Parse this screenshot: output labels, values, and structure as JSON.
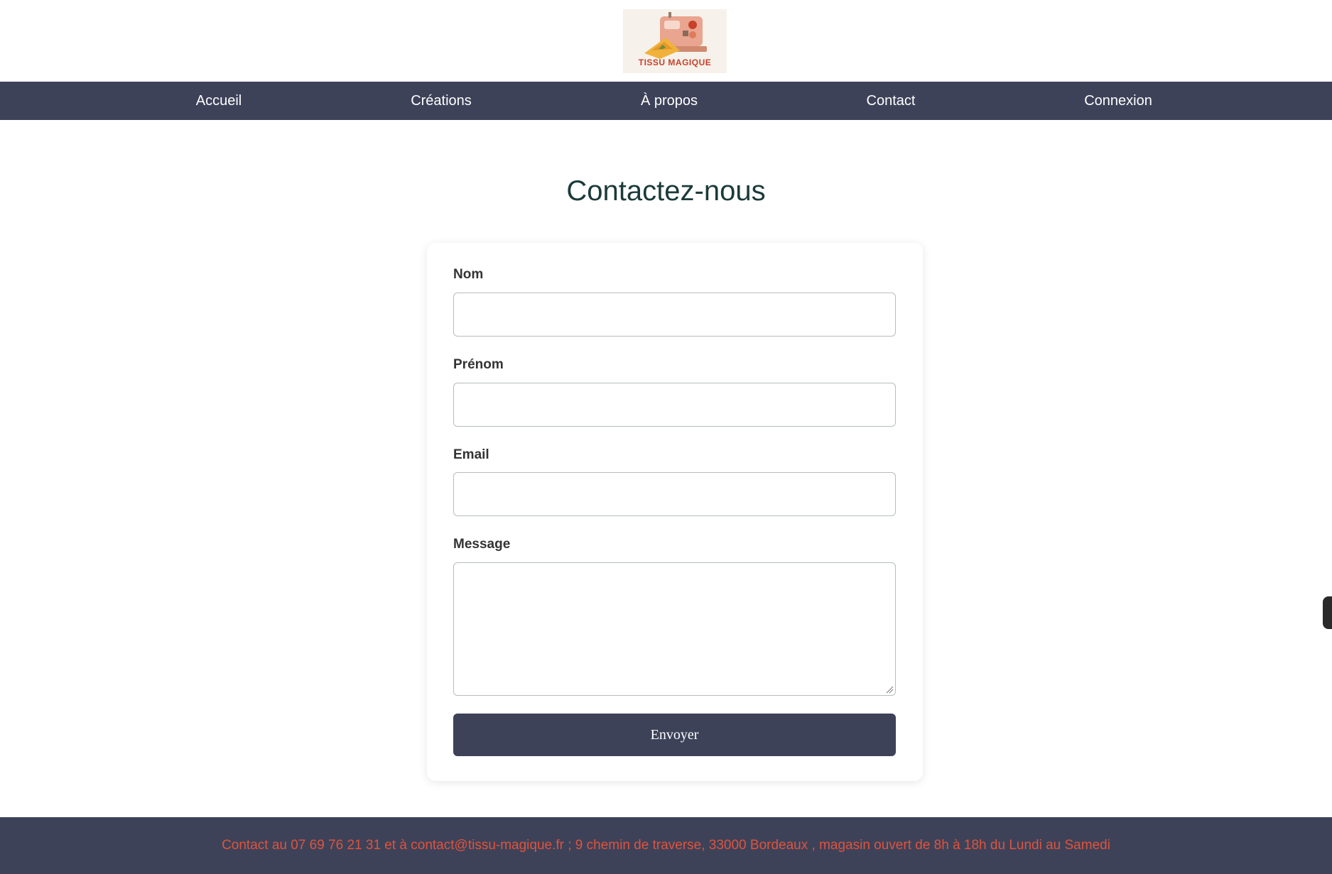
{
  "logo": {
    "text": "TISSU MAGIQUE",
    "icon": "sewing-machine-icon"
  },
  "nav": {
    "items": [
      {
        "label": "Accueil"
      },
      {
        "label": "Créations"
      },
      {
        "label": "À propos"
      },
      {
        "label": "Contact"
      },
      {
        "label": "Connexion"
      }
    ]
  },
  "page": {
    "title": "Contactez-nous"
  },
  "form": {
    "nom_label": "Nom",
    "nom_value": "",
    "prenom_label": "Prénom",
    "prenom_value": "",
    "email_label": "Email",
    "email_value": "",
    "message_label": "Message",
    "message_value": "",
    "submit_label": "Envoyer"
  },
  "footer": {
    "text": "Contact au 07 69 76 21 31 et à contact@tissu-magique.fr ; 9 chemin de traverse, 33000 Bordeaux , magasin ouvert de 8h à 18h du Lundi au Samedi"
  },
  "colors": {
    "nav_background": "#3d4259",
    "footer_text": "#e0533c",
    "title": "#1c3a3a"
  }
}
